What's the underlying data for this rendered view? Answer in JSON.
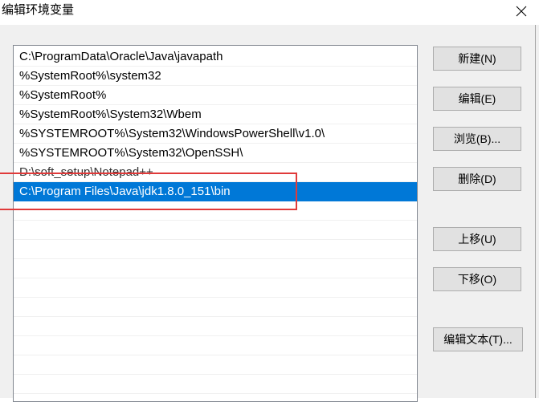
{
  "window": {
    "title": "编辑环境变量",
    "close_icon": "close-icon"
  },
  "path_list": {
    "items": [
      "C:\\ProgramData\\Oracle\\Java\\javapath",
      "%SystemRoot%\\system32",
      "%SystemRoot%",
      "%SystemRoot%\\System32\\Wbem",
      "%SYSTEMROOT%\\System32\\WindowsPowerShell\\v1.0\\",
      "%SYSTEMROOT%\\System32\\OpenSSH\\",
      "D:\\soft_setup\\Notepad++",
      "C:\\Program Files\\Java\\jdk1.8.0_151\\bin"
    ],
    "selected_index": 7,
    "selection_color": "#0078d7"
  },
  "buttons": {
    "new": "新建(N)",
    "edit": "编辑(E)",
    "browse": "浏览(B)...",
    "delete": "删除(D)",
    "move_up": "上移(U)",
    "move_down": "下移(O)",
    "edit_text": "编辑文本(T)..."
  },
  "annotation": {
    "highlight_color": "#e03a3a"
  }
}
